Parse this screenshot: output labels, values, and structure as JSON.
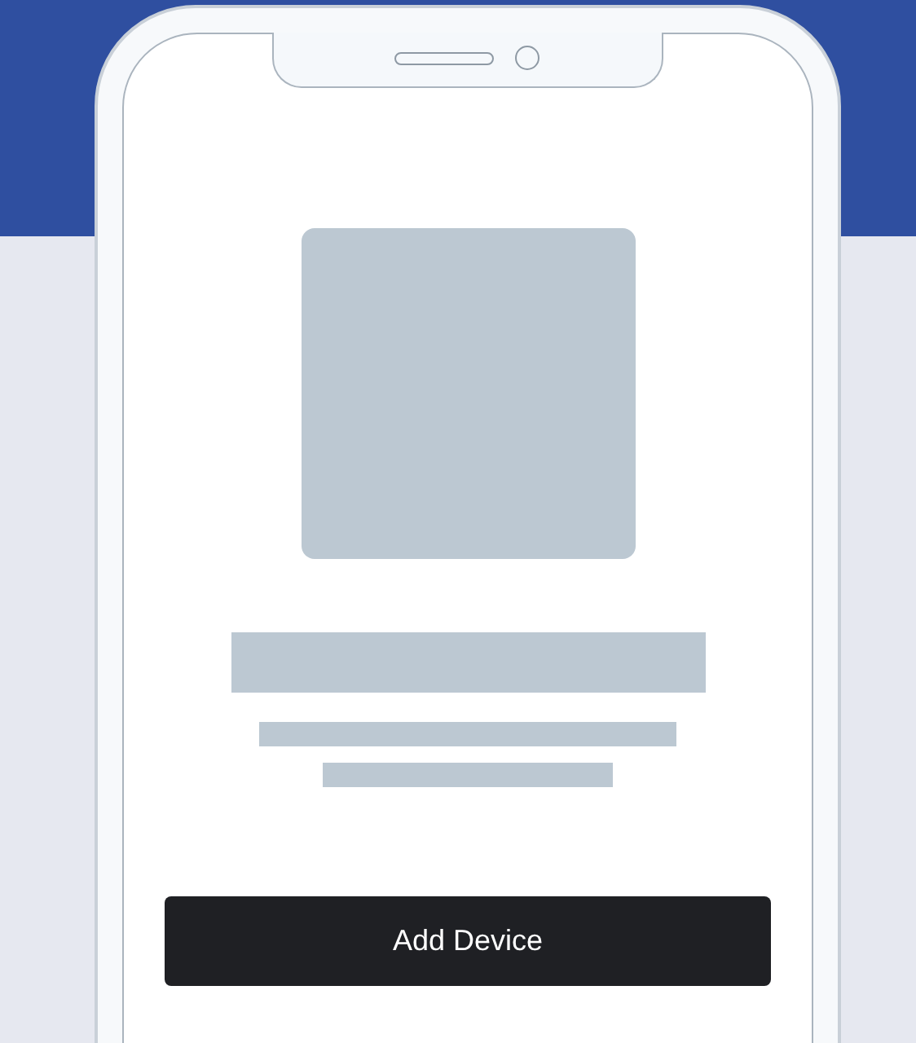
{
  "button": {
    "label": "Add Device"
  }
}
